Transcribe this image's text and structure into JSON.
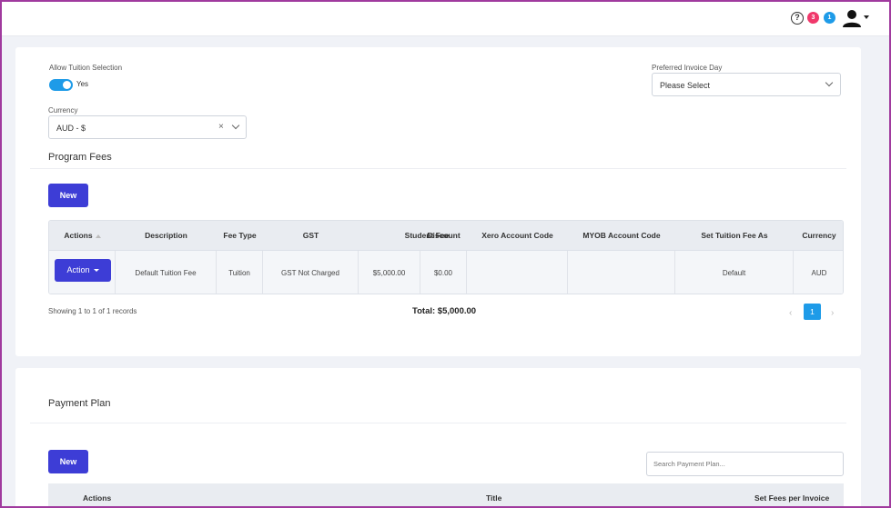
{
  "header": {
    "help_icon": "?",
    "notification_count": "3",
    "message_count": "1",
    "colors": {
      "red": "#f0386b",
      "blue": "#1e9be8"
    }
  },
  "settings": {
    "allow_tuition_label": "Allow Tuition Selection",
    "allow_tuition_value": "Yes",
    "preferred_invoice_label": "Preferred Invoice Day",
    "preferred_invoice_placeholder": "Please Select",
    "currency_label": "Currency",
    "currency_value": "AUD - $",
    "clear_icon": "×"
  },
  "program_fees": {
    "title": "Program Fees",
    "new_label": "New",
    "columns": [
      "Actions",
      "Description",
      "Fee Type",
      "GST",
      "Student Fee",
      "Discount",
      "Xero Account Code",
      "MYOB Account Code",
      "Set Tuition Fee As",
      "Currency"
    ],
    "row": {
      "action_label": "Action",
      "description": "Default Tuition Fee",
      "fee_type": "Tuition",
      "gst": "GST Not Charged",
      "student_fee": "$5,000.00",
      "discount": "$0.00",
      "xero": "",
      "myob": "",
      "set_as": "Default",
      "currency": "AUD"
    },
    "showing": "Showing 1 to 1 of 1 records",
    "total": "Total: $5,000.00",
    "pagination": {
      "prev": "‹",
      "current": "1",
      "next": "›"
    }
  },
  "payment_plan": {
    "title": "Payment Plan",
    "new_label": "New",
    "search_placeholder": "Search Payment Plan...",
    "columns": [
      "Actions",
      "Title",
      "Set Fees per Invoice"
    ]
  },
  "accent_color": "#3d3dd6"
}
